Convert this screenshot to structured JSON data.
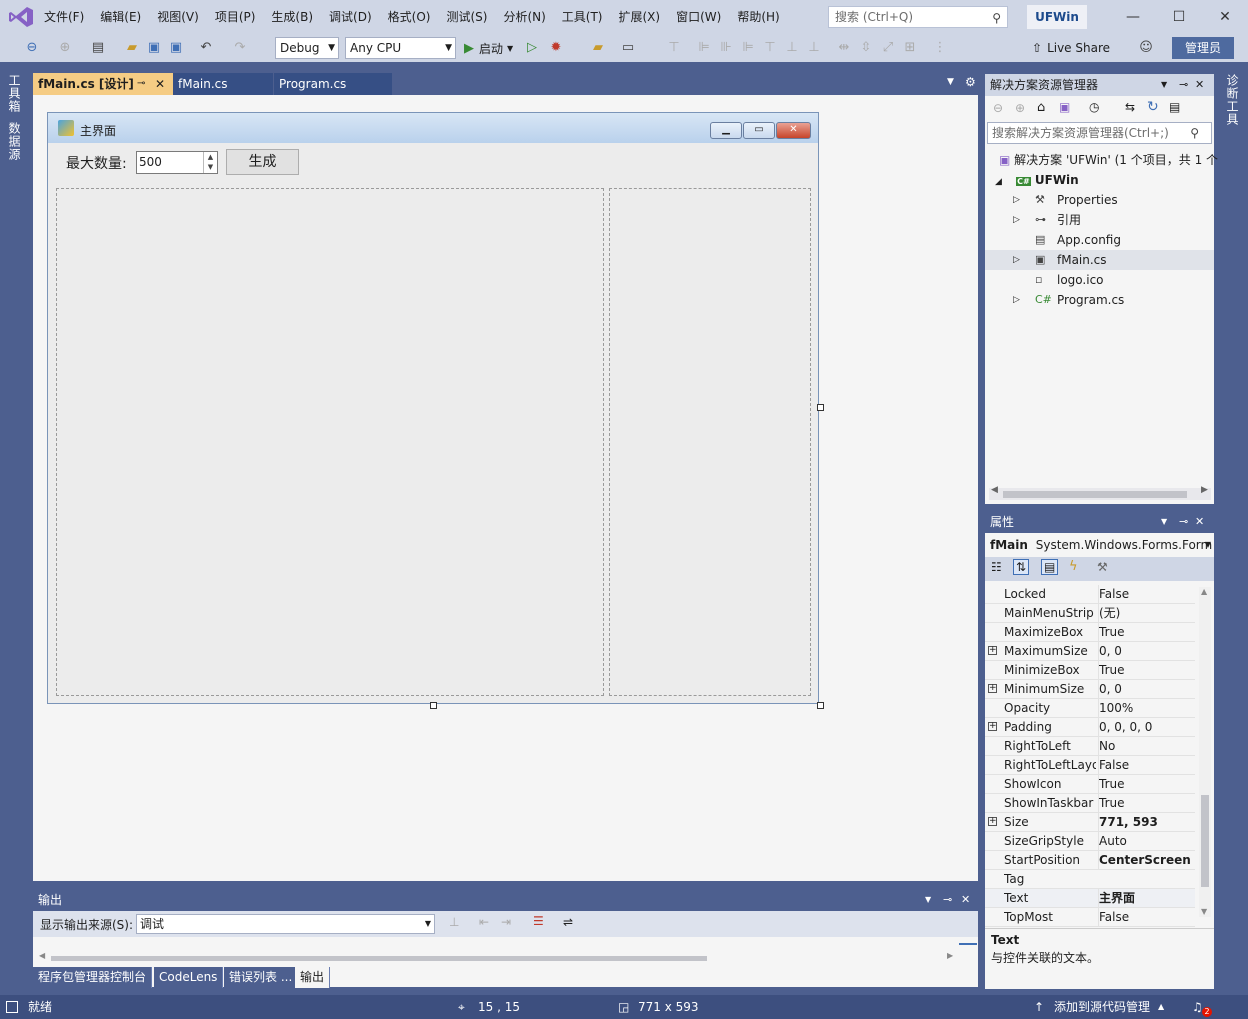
{
  "titlebar": {
    "menu": [
      "文件(F)",
      "编辑(E)",
      "视图(V)",
      "项目(P)",
      "生成(B)",
      "调试(D)",
      "格式(O)",
      "测试(S)",
      "分析(N)",
      "工具(T)",
      "扩展(X)",
      "窗口(W)",
      "帮助(H)"
    ],
    "search_placeholder": "搜索 (Ctrl+Q)",
    "project_name": "UFWin"
  },
  "toolbar": {
    "config": "Debug",
    "platform": "Any CPU",
    "start_label": "启动",
    "live_share": "Live Share",
    "admin_label": "管理员"
  },
  "left_strip": {
    "toolbox": "工具箱",
    "datasources": "数据源"
  },
  "right_strip": {
    "diagnostics": "诊断工具"
  },
  "doc_tabs": [
    {
      "label": "fMain.cs [设计]",
      "active": true
    },
    {
      "label": "fMain.cs",
      "active": false
    },
    {
      "label": "Program.cs",
      "active": false
    }
  ],
  "form": {
    "title": "主界面",
    "max_label": "最大数量:",
    "max_value": "500",
    "generate_label": "生成"
  },
  "solution_explorer": {
    "title": "解决方案资源管理器",
    "search_placeholder": "搜索解决方案资源管理器(Ctrl+;)",
    "solution_label": "解决方案 'UFWin' (1 个项目，共 1 个",
    "project": "UFWin",
    "items": [
      {
        "label": "Properties",
        "icon": "wrench-icon",
        "expander": true
      },
      {
        "label": "引用",
        "icon": "references-icon",
        "expander": true
      },
      {
        "label": "App.config",
        "icon": "config-icon",
        "expander": false
      },
      {
        "label": "fMain.cs",
        "icon": "form-icon",
        "expander": true,
        "selected": true
      },
      {
        "label": "logo.ico",
        "icon": "image-icon",
        "expander": false
      },
      {
        "label": "Program.cs",
        "icon": "csharp-icon",
        "expander": true
      }
    ]
  },
  "properties": {
    "title": "属性",
    "object_name": "fMain",
    "object_type": "System.Windows.Forms.Form",
    "rows": [
      {
        "name": "Locked",
        "value": "False",
        "expand": false,
        "bold": false
      },
      {
        "name": "MainMenuStrip",
        "value": "(无)",
        "expand": false,
        "bold": false
      },
      {
        "name": "MaximizeBox",
        "value": "True",
        "expand": false,
        "bold": false
      },
      {
        "name": "MaximumSize",
        "value": "0, 0",
        "expand": true,
        "bold": false
      },
      {
        "name": "MinimizeBox",
        "value": "True",
        "expand": false,
        "bold": false
      },
      {
        "name": "MinimumSize",
        "value": "0, 0",
        "expand": true,
        "bold": false
      },
      {
        "name": "Opacity",
        "value": "100%",
        "expand": false,
        "bold": false
      },
      {
        "name": "Padding",
        "value": "0, 0, 0, 0",
        "expand": true,
        "bold": false
      },
      {
        "name": "RightToLeft",
        "value": "No",
        "expand": false,
        "bold": false
      },
      {
        "name": "RightToLeftLayo",
        "value": "False",
        "expand": false,
        "bold": false
      },
      {
        "name": "ShowIcon",
        "value": "True",
        "expand": false,
        "bold": false
      },
      {
        "name": "ShowInTaskbar",
        "value": "True",
        "expand": false,
        "bold": false
      },
      {
        "name": "Size",
        "value": "771, 593",
        "expand": true,
        "bold": true
      },
      {
        "name": "SizeGripStyle",
        "value": "Auto",
        "expand": false,
        "bold": false
      },
      {
        "name": "StartPosition",
        "value": "CenterScreen",
        "expand": false,
        "bold": true
      },
      {
        "name": "Tag",
        "value": "",
        "expand": false,
        "bold": false
      },
      {
        "name": "Text",
        "value": "主界面",
        "expand": false,
        "bold": true,
        "selected": true
      },
      {
        "name": "TopMost",
        "value": "False",
        "expand": false,
        "bold": false
      }
    ],
    "desc_title": "Text",
    "desc_text": "与控件关联的文本。"
  },
  "output": {
    "title": "输出",
    "source_label": "显示输出来源(S):",
    "source_value": "调试",
    "tabs": [
      "程序包管理器控制台",
      "CodeLens",
      "错误列表 ...",
      "输出"
    ]
  },
  "statusbar": {
    "status": "就绪",
    "position": "15 , 15",
    "size": "771 x 593",
    "source_control": "添加到源代码管理",
    "notifications": "2"
  }
}
